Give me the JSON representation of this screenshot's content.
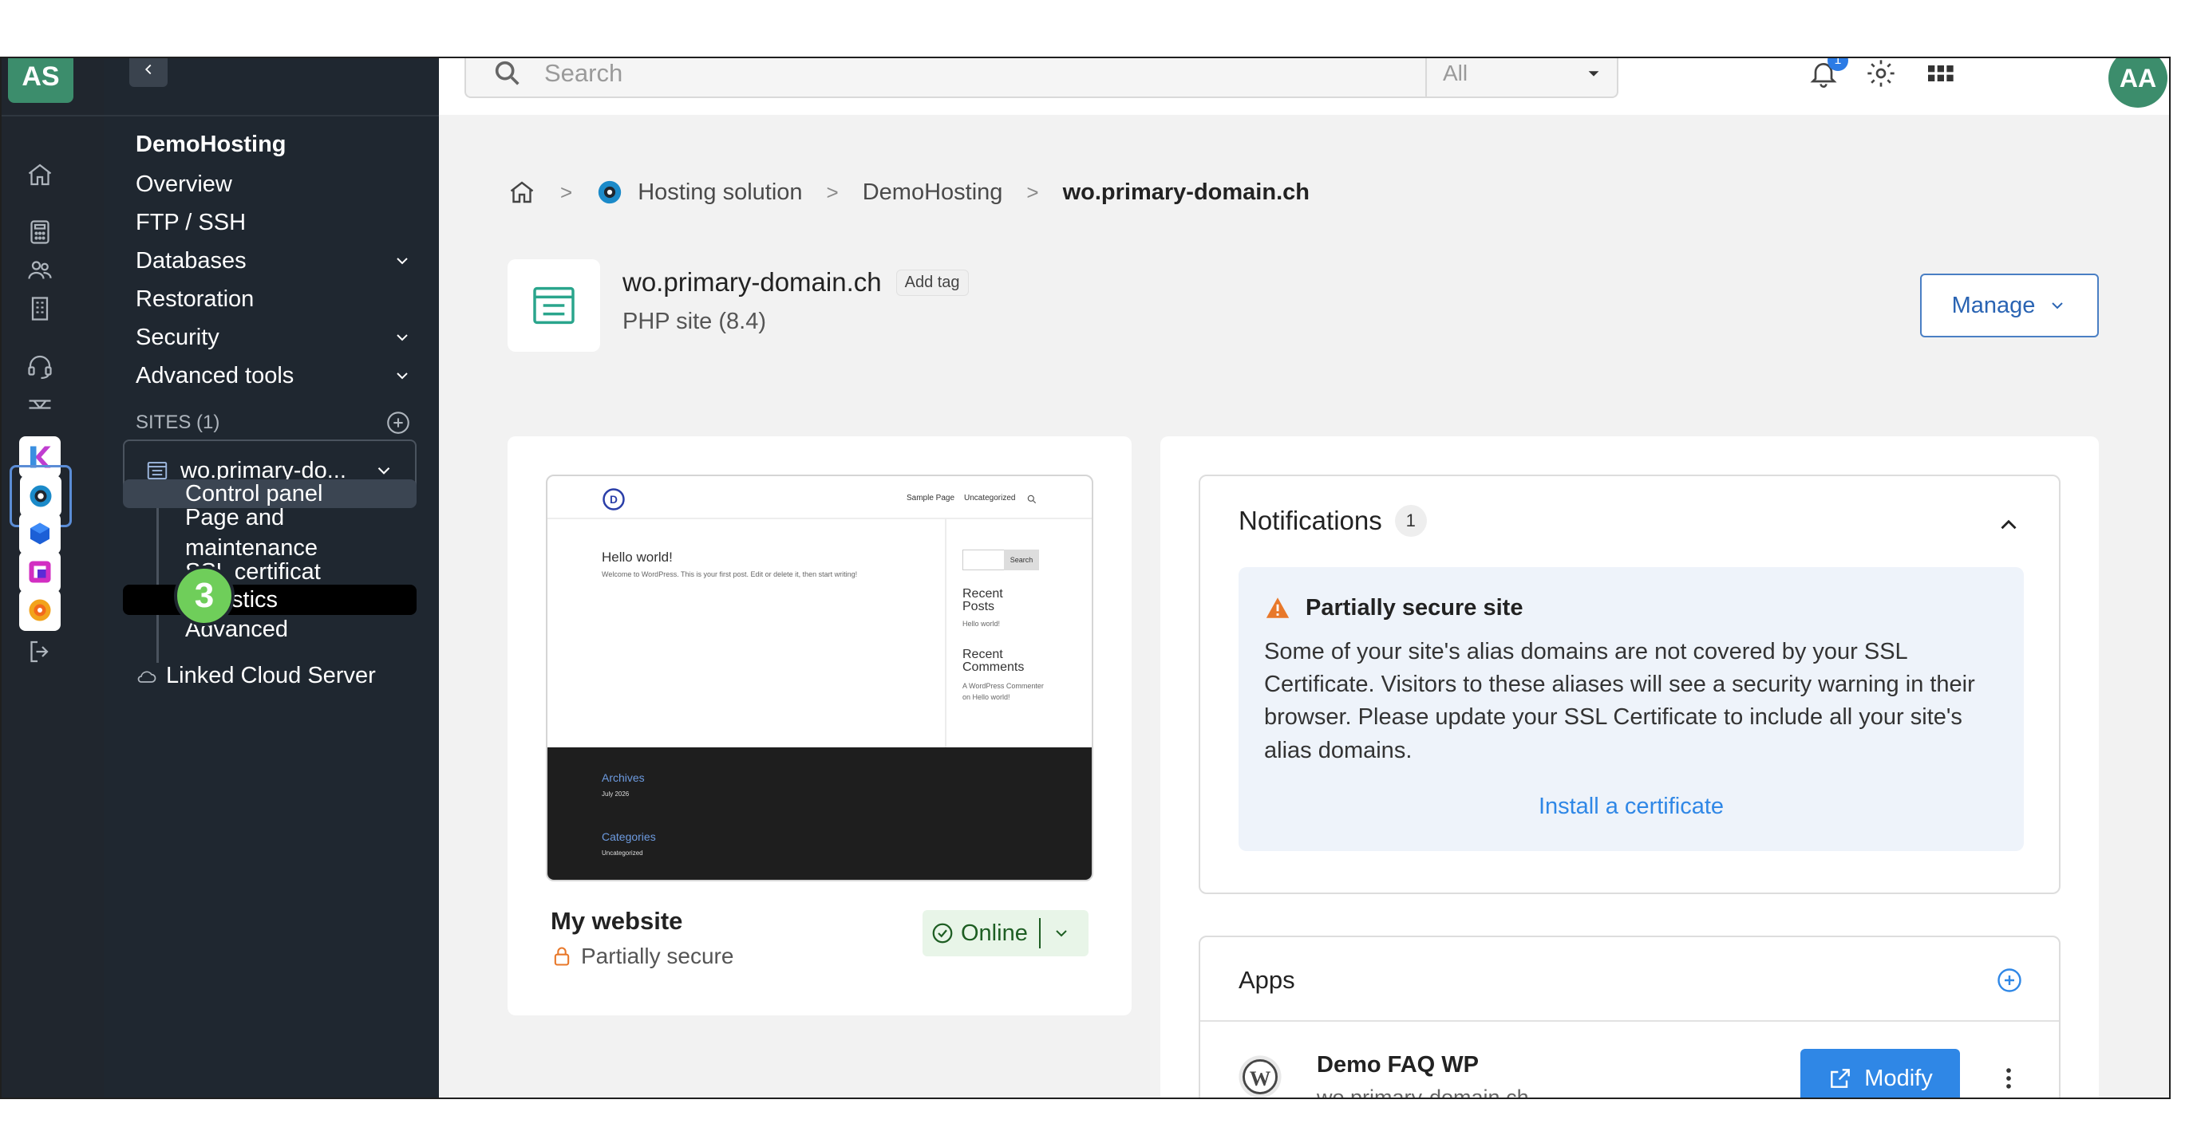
{
  "rail": {
    "avatar_initials": "AS",
    "icons": [
      "home-icon",
      "calculator-icon",
      "users-icon",
      "building-icon",
      "headset-icon",
      "network-icon"
    ],
    "apps": [
      "kchat-app",
      "hosting-app",
      "kdrive-app",
      "kmeet-app",
      "kpaint-app"
    ],
    "logout_icon": "logout-icon"
  },
  "nav": {
    "product": "DemoHosting",
    "items": [
      {
        "label": "Overview",
        "expandable": false
      },
      {
        "label": "FTP / SSH",
        "expandable": false
      },
      {
        "label": "Databases",
        "expandable": true
      },
      {
        "label": "Restoration",
        "expandable": false
      },
      {
        "label": "Security",
        "expandable": true
      },
      {
        "label": "Advanced tools",
        "expandable": true
      }
    ],
    "sites_header": "SITES (1)",
    "site_selected": "wo.primary-do...",
    "sub_items": [
      {
        "label": "Control panel"
      },
      {
        "label": "Page and maintenance"
      },
      {
        "label": "SSL certificat"
      },
      {
        "label": "Statistics"
      },
      {
        "label": "Advanced"
      }
    ],
    "linked": "Linked Cloud Server",
    "step_number": "3"
  },
  "topbar": {
    "search_placeholder": "Search",
    "scope": "All",
    "notification_count": "1",
    "user_initials": "AA"
  },
  "breadcrumb": {
    "items": [
      "Hosting solution",
      "DemoHosting"
    ],
    "current": "wo.primary-domain.ch"
  },
  "site": {
    "name": "wo.primary-domain.ch",
    "tag_label": "Add tag",
    "type": "PHP site (8.4)",
    "manage_label": "Manage"
  },
  "preview": {
    "nav_links": [
      "Sample Page",
      "Uncategorized"
    ],
    "post_title": "Hello world!",
    "post_text": "Welcome to WordPress. This is your first post. Edit or delete it, then start writing!",
    "search_btn": "Search",
    "recent_posts_title": "Recent Posts",
    "recent_posts_item": "Hello world!",
    "recent_comments_title": "Recent Comments",
    "recent_comments_item": "A WordPress Commenter on Hello world!",
    "archives_title": "Archives",
    "archives_item": "July 2026",
    "categories_title": "Categories",
    "categories_item": "Uncategorized",
    "site_label": "My website",
    "security_status": "Partially secure",
    "online_label": "Online"
  },
  "notifications": {
    "title": "Notifications",
    "count": "1",
    "alert_title": "Partially secure site",
    "alert_body": "Some of your site's alias domains are not covered by your SSL Certificate. Visitors to these aliases will see a security warning in their browser. Please update your SSL Certificate to include all your site's alias domains.",
    "action": "Install a certificate"
  },
  "apps": {
    "title": "Apps",
    "app_name": "Demo FAQ WP",
    "app_domain": "wo.primary-domain.ch",
    "modify_label": "Modify"
  },
  "colors": {
    "sidebar_bg": "#1f2730",
    "rail_bg": "#20262e",
    "accent_blue": "#2f87e6",
    "status_green_bg": "#e8f5e8",
    "step_badge_green": "#6fce5a",
    "warning_orange": "#e8782a"
  }
}
